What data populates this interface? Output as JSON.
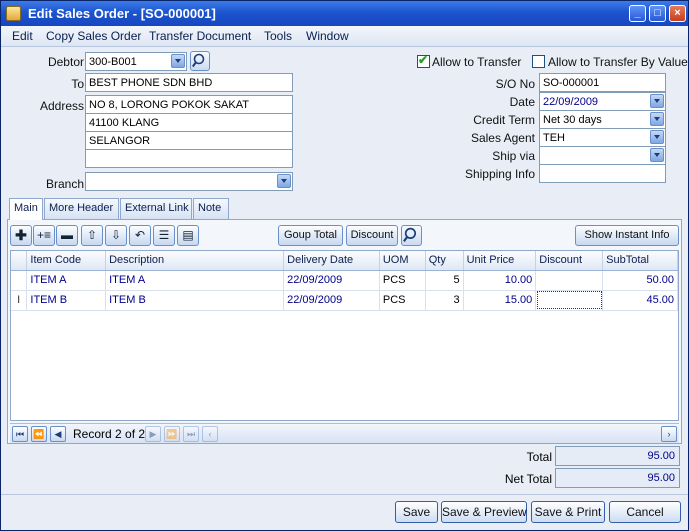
{
  "window": {
    "title": "Edit Sales Order - [SO-000001]"
  },
  "menu": [
    "Edit",
    "Copy Sales Order",
    "Transfer Document",
    "Tools",
    "Window"
  ],
  "form": {
    "debtor_label": "Debtor",
    "debtor": "300-B001",
    "to_label": "To",
    "to": "BEST PHONE SDN BHD",
    "address_label": "Address",
    "address": [
      "NO 8, LORONG POKOK SAKAT",
      "41100 KLANG",
      "SELANGOR",
      ""
    ],
    "branch_label": "Branch",
    "branch": "",
    "allow_transfer_label": "Allow to Transfer",
    "allow_transfer": true,
    "allow_transfer_value_label": "Allow to Transfer By Value",
    "allow_transfer_value": false,
    "so_no_label": "S/O  No",
    "so_no": "SO-000001",
    "date_label": "Date",
    "date": "22/09/2009",
    "credit_term_label": "Credit Term",
    "credit_term": "Net 30 days",
    "sales_agent_label": "Sales Agent",
    "sales_agent": "TEH",
    "ship_via_label": "Ship via",
    "ship_via": "",
    "shipping_info_label": "Shipping Info",
    "shipping_info": ""
  },
  "tabs": [
    "Main",
    "More Header",
    "External Link",
    "Note"
  ],
  "toolbar": {
    "group_total": "Goup Total",
    "discount": "Discount",
    "show_info": "Show Instant Info"
  },
  "grid": {
    "columns": [
      "Item Code",
      "Description",
      "Delivery Date",
      "UOM",
      "Qty",
      "Unit Price",
      "Discount",
      "SubTotal"
    ],
    "rows": [
      {
        "indicator": "",
        "item_code": "ITEM A",
        "description": "ITEM A",
        "delivery_date": "22/09/2009",
        "uom": "PCS",
        "qty": "5",
        "unit_price": "10.00",
        "discount": "",
        "subtotal": "50.00"
      },
      {
        "indicator": "I",
        "item_code": "ITEM B",
        "description": "ITEM B",
        "delivery_date": "22/09/2009",
        "uom": "PCS",
        "qty": "3",
        "unit_price": "15.00",
        "discount": "",
        "subtotal": "45.00"
      }
    ]
  },
  "navigator": {
    "record": "Record 2 of 2"
  },
  "totals": {
    "total_label": "Total",
    "total": "95.00",
    "net_total_label": "Net Total",
    "net_total": "95.00"
  },
  "actions": {
    "save": "Save",
    "save_preview": "Save & Preview",
    "save_print": "Save & Print",
    "cancel": "Cancel"
  }
}
